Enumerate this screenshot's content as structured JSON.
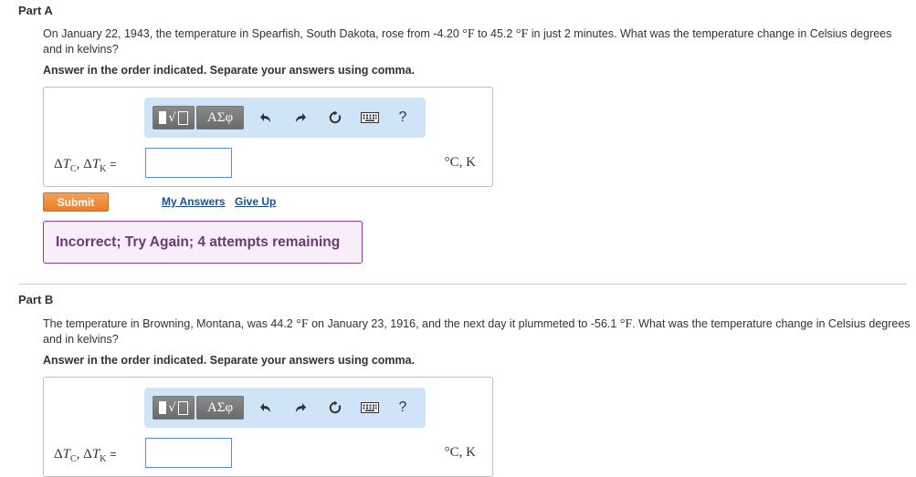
{
  "part_a": {
    "title": "Part A",
    "question": {
      "t1": "On January 22, 1943, the temperature in Spearfish, South Dakota, rose from -4.20 ",
      "u1": "°F",
      "t2": " to 45.2 ",
      "u2": "°F",
      "t3": " in just 2 minutes. What was the temperature change in Celsius degrees and in kelvins?"
    },
    "instruction": "Answer in the order indicated. Separate your answers using comma.",
    "toolbar": {
      "greek_label": "ΑΣφ",
      "help_label": "?"
    },
    "variable": {
      "d1": "Δ",
      "v1": "T",
      "s1": "C",
      "sep": ", ",
      "d2": "Δ",
      "v2": "T",
      "s2": "K",
      "eq": "="
    },
    "input_value": "",
    "units": "°C, K",
    "submit_label": "Submit",
    "my_answers_label": "My Answers",
    "give_up_label": "Give Up",
    "feedback": "Incorrect; Try Again; 4 attempts remaining"
  },
  "part_b": {
    "title": "Part B",
    "question": {
      "t1": "The temperature in Browning, Montana, was 44.2 ",
      "u1": "°F",
      "t2": " on January 23, 1916, and the next day it plummeted to -56.1 ",
      "u2": "°F",
      "t3": ". What was the temperature change in Celsius degrees and in kelvins?"
    },
    "instruction": "Answer in the order indicated. Separate your answers using comma.",
    "toolbar": {
      "greek_label": "ΑΣφ",
      "help_label": "?"
    },
    "variable": {
      "d1": "Δ",
      "v1": "T",
      "s1": "C",
      "sep": ", ",
      "d2": "Δ",
      "v2": "T",
      "s2": "K",
      "eq": "="
    },
    "input_value": "",
    "units": "°C, K"
  },
  "colors": {
    "toolbar_bg": "#cfe5f7",
    "submit_bg": "#ee7d28",
    "link": "#1a4f9c",
    "feedback_border": "#8e3b96",
    "feedback_text": "#6b3a73",
    "input_border": "#4a90e2"
  }
}
